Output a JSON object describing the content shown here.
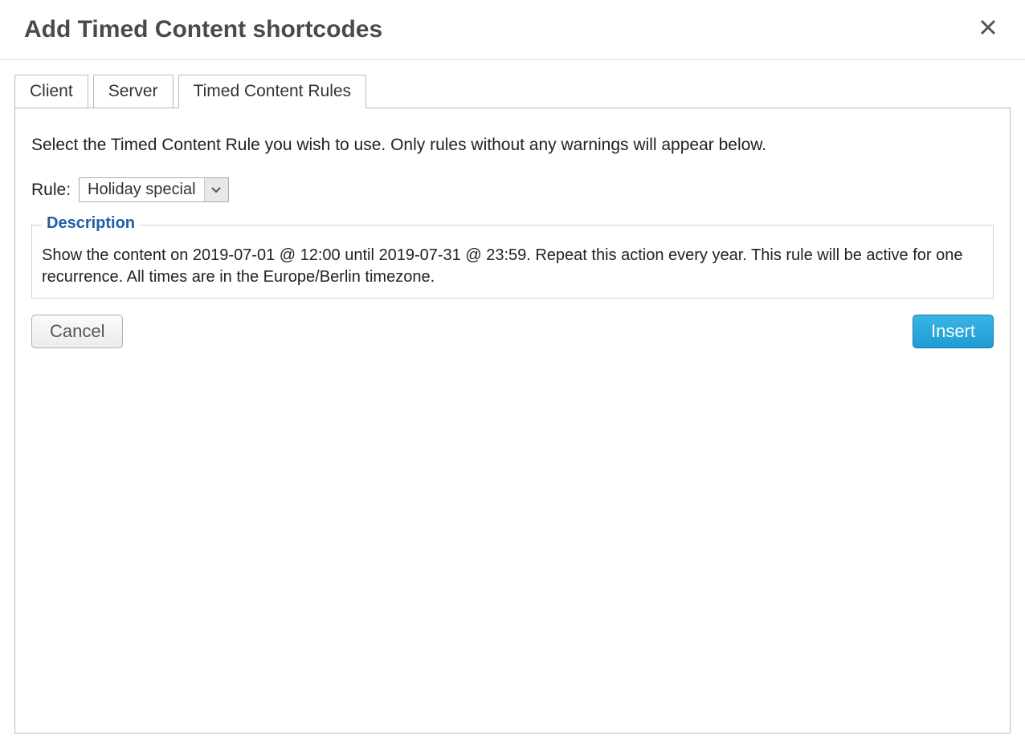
{
  "dialog": {
    "title": "Add Timed Content shortcodes"
  },
  "tabs": [
    {
      "label": "Client",
      "active": false
    },
    {
      "label": "Server",
      "active": false
    },
    {
      "label": "Timed Content Rules",
      "active": true
    }
  ],
  "panel": {
    "instruction": "Select the Timed Content Rule you wish to use. Only rules without any warnings will appear below.",
    "rule_label": "Rule:",
    "rule_selected": "Holiday special",
    "description_legend": "Description",
    "description_text": "Show the content on 2019-07-01 @ 12:00 until 2019-07-31 @ 23:59. Repeat this action every year. This rule will be active for one recurrence. All times are in the Europe/Berlin timezone."
  },
  "buttons": {
    "cancel": "Cancel",
    "insert": "Insert"
  }
}
